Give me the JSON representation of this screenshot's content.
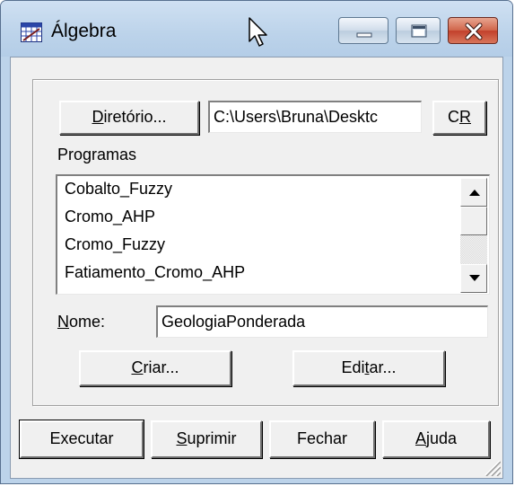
{
  "window": {
    "title": "Álgebra",
    "icons": {
      "app": "grid-table-icon",
      "cursor": "mouse-pointer-icon",
      "minimize": "minimize-icon",
      "maximize": "maximize-icon",
      "close": "close-icon"
    },
    "colors": {
      "frame": "#bcd3ea",
      "client": "#f0f0f0",
      "close": "#c2402b"
    }
  },
  "directory": {
    "button_pre": "D",
    "button_rest": "iretório...",
    "path_value": "C:\\Users\\Bruna\\Desktc",
    "cr_pre": "C",
    "cr_u": "R"
  },
  "programs": {
    "label": "Programas",
    "items": [
      "Cobalto_Fuzzy",
      "Cromo_AHP",
      "Cromo_Fuzzy",
      "Fatiamento_Cromo_AHP"
    ],
    "scroll_icons": {
      "up": "arrow-up-icon",
      "down": "arrow-down-icon"
    }
  },
  "name": {
    "label_u": "N",
    "label_rest": "ome:",
    "value": "GeologiaPonderada"
  },
  "actions": {
    "create_u": "C",
    "create_rest": "riar...",
    "edit_pre": "Edi",
    "edit_u": "t",
    "edit_rest": "ar..."
  },
  "footer": {
    "execute": "Executar",
    "delete_u": "S",
    "delete_rest": "uprimir",
    "close": "Fechar",
    "help_u": "A",
    "help_rest": "juda"
  }
}
